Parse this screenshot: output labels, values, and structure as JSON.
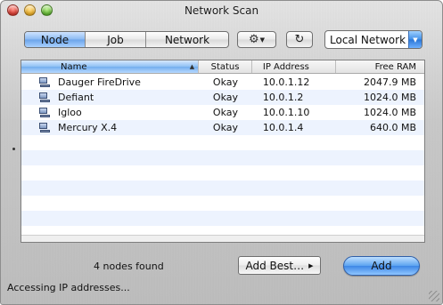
{
  "window": {
    "title": "Network Scan"
  },
  "toolbar": {
    "segments": [
      {
        "label": "Node",
        "selected": true
      },
      {
        "label": "Job",
        "selected": false
      },
      {
        "label": "Network",
        "selected": false
      }
    ],
    "gear_icon": "gear-icon",
    "refresh_icon": "refresh-icon",
    "popup_value": "Local Network"
  },
  "table": {
    "columns": [
      "Name",
      "Status",
      "IP Address",
      "Free RAM"
    ],
    "sorted_column": "Name",
    "rows": [
      {
        "name": "Dauger FireDrive",
        "status": "Okay",
        "ip": "10.0.1.12",
        "ram": "2047.9 MB"
      },
      {
        "name": "Defiant",
        "status": "Okay",
        "ip": "10.0.1.2",
        "ram": "1024.0 MB"
      },
      {
        "name": "Igloo",
        "status": "Okay",
        "ip": "10.0.1.10",
        "ram": "1024.0 MB"
      },
      {
        "name": "Mercury X.4",
        "status": "Okay",
        "ip": "10.0.1.4",
        "ram": "640.0 MB"
      }
    ]
  },
  "footer": {
    "count_text": "4 nodes found",
    "add_best_label": "Add Best…",
    "add_label": "Add",
    "status_message": "Accessing IP addresses..."
  },
  "colors": {
    "selected_blue": "#6aa3ea",
    "row_stripe": "#edf3fe"
  }
}
